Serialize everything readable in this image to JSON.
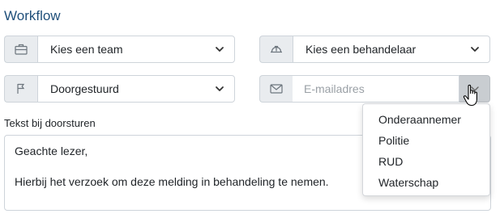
{
  "section": {
    "title": "Workflow"
  },
  "team_select": {
    "icon": "briefcase-icon",
    "value": "Kies een team"
  },
  "handler_select": {
    "icon": "hardhat-icon",
    "value": "Kies een behandelaar"
  },
  "status_select": {
    "icon": "flag-icon",
    "value": "Doorgestuurd"
  },
  "email": {
    "icon": "envelope-icon",
    "placeholder": "E-mailadres",
    "button_icon": "chevron-down-icon"
  },
  "forward_text": {
    "label": "Tekst bij doorsturen",
    "line1": "Geachte lezer,",
    "line2": "Hierbij het verzoek om deze melding in behandeling te nemen."
  },
  "recipient_menu": {
    "items": [
      {
        "label": "Onderaannemer"
      },
      {
        "label": "Politie"
      },
      {
        "label": "RUD"
      },
      {
        "label": "Waterschap"
      }
    ]
  },
  "colors": {
    "title": "#1f4f7a",
    "addon_bg": "#e9ecef",
    "border": "#ced4da",
    "button_bg": "#c9cdd1"
  }
}
